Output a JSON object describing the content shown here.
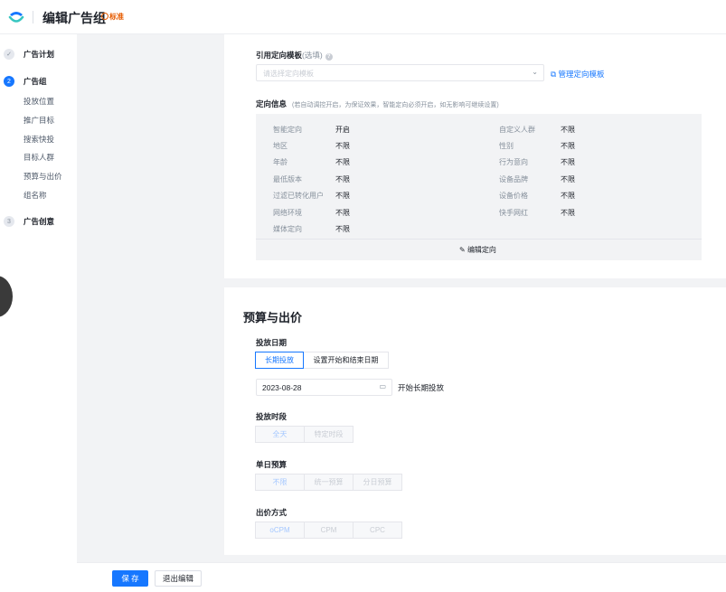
{
  "header": {
    "title": "编辑广告组",
    "badge": "标准"
  },
  "sidebar": {
    "steps": [
      {
        "num": "✓",
        "label": "广告计划"
      },
      {
        "num": "2",
        "label": "广告组"
      },
      {
        "num": "3",
        "label": "广告创意"
      }
    ],
    "sub_items": [
      "投放位置",
      "推广目标",
      "搜索快投",
      "目标人群",
      "预算与出价",
      "组名称"
    ]
  },
  "template": {
    "title": "引用定向模板",
    "optional": "(选填)",
    "placeholder": "请选择定向模板",
    "manage_link": "管理定向模板"
  },
  "targeting": {
    "title": "定向信息",
    "hint": "(若自动调控开启，为保证效果，智能定向必须开启，如无影响可继续设置)",
    "left": [
      {
        "label": "智能定向",
        "value": "开启"
      },
      {
        "label": "地区",
        "value": "不限"
      },
      {
        "label": "年龄",
        "value": "不限"
      },
      {
        "label": "最低版本",
        "value": "不限"
      },
      {
        "label": "过滤已转化用户",
        "value": "不限"
      },
      {
        "label": "网络环境",
        "value": "不限"
      },
      {
        "label": "媒体定向",
        "value": "不限"
      }
    ],
    "right": [
      {
        "label": "自定义人群",
        "value": "不限"
      },
      {
        "label": "性别",
        "value": "不限"
      },
      {
        "label": "行为意向",
        "value": "不限"
      },
      {
        "label": "设备品牌",
        "value": "不限"
      },
      {
        "label": "设备价格",
        "value": "不限"
      },
      {
        "label": "快手网红",
        "value": "不限"
      }
    ],
    "edit_label": "编辑定向"
  },
  "budget": {
    "section_title": "预算与出价",
    "date_title": "投放日期",
    "date_options": [
      "长期投放",
      "设置开始和结束日期"
    ],
    "date_value": "2023-08-28",
    "date_note": "开始长期投放",
    "period_title": "投放时段",
    "period_options": [
      "全天",
      "特定时段"
    ],
    "daily_title": "单日预算",
    "daily_options": [
      "不限",
      "统一预算",
      "分日预算"
    ],
    "bid_title": "出价方式",
    "bid_options": [
      "oCPM",
      "CPM",
      "CPC"
    ]
  },
  "footer": {
    "save": "保 存",
    "exit": "退出编辑"
  },
  "colors": {
    "primary": "#1677ff",
    "badge": "#e65b00"
  }
}
